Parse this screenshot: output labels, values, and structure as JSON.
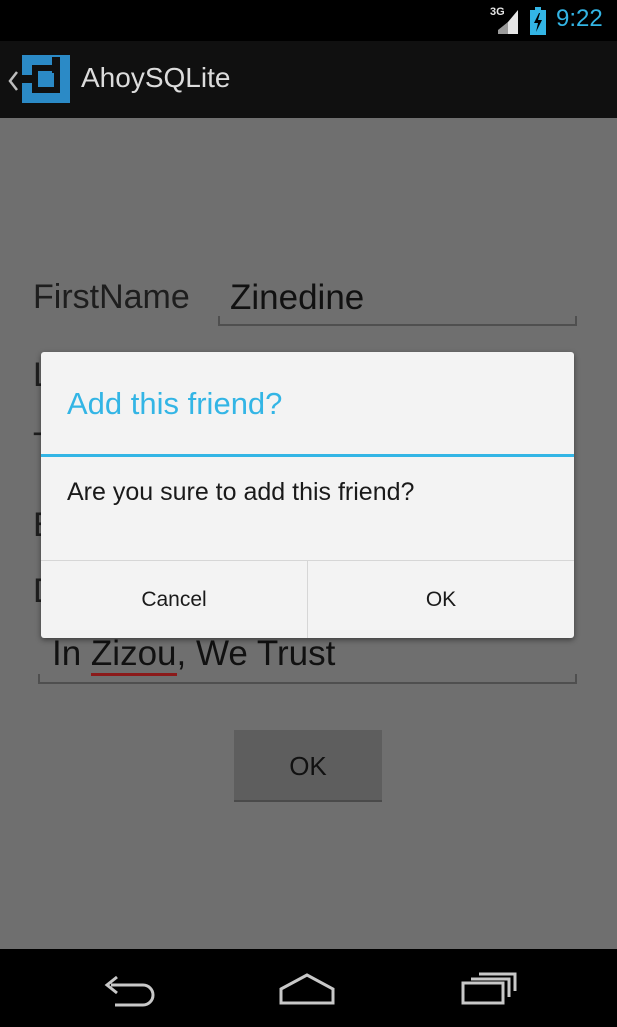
{
  "status_bar": {
    "network_label": "3G",
    "time": "9:22",
    "icons": [
      "signal-icon",
      "battery-charging-icon"
    ]
  },
  "action_bar": {
    "app_title": "AhoySQLite",
    "icons": [
      "up-caret-icon",
      "app-logo-icon"
    ]
  },
  "form": {
    "first_name_label": "FirstName",
    "first_name_value": "Zinedine",
    "partial_labels": [
      "L",
      "T",
      "E",
      "D"
    ],
    "description_value_misspelled": "Zizou",
    "description_value_prefix": "In ",
    "description_value_suffix": ", We Trust",
    "ok_button_label": "OK"
  },
  "dialog": {
    "title": "Add this friend?",
    "message": "Are you sure to add this friend?",
    "cancel_label": "Cancel",
    "ok_label": "OK"
  },
  "nav_bar": {
    "icons": [
      "back-icon",
      "home-icon",
      "recent-apps-icon"
    ]
  },
  "colors": {
    "accent": "#33b5e5",
    "dim_overlay": "#6f6f6f",
    "dialog_bg": "#f3f3f3"
  }
}
